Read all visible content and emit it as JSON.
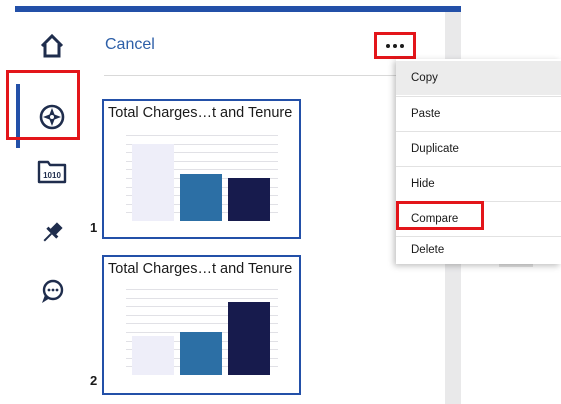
{
  "panel": {
    "cancel_label": "Cancel",
    "more_label": "More options"
  },
  "rail": {
    "items": [
      {
        "name": "home",
        "icon": "home-icon"
      },
      {
        "name": "navigate",
        "icon": "compass-icon",
        "active": true
      },
      {
        "name": "data",
        "icon": "binary-data-icon",
        "label": "1010"
      },
      {
        "name": "pin",
        "icon": "pin-icon"
      },
      {
        "name": "comments",
        "icon": "chat-icon"
      }
    ]
  },
  "cards": [
    {
      "number": "1",
      "title": "Total Charges…t and Tenure"
    },
    {
      "number": "2",
      "title": "Total Charges…t and Tenure"
    }
  ],
  "chart_data": [
    {
      "type": "bar",
      "values": [
        0.9,
        0.55,
        0.5
      ],
      "colors": [
        "#eeeef9",
        "#2c6fa5",
        "#171b4d"
      ]
    },
    {
      "type": "bar",
      "values": [
        0.45,
        0.5,
        0.85
      ],
      "colors": [
        "#eeeef9",
        "#2c6fa5",
        "#171b4d"
      ]
    }
  ],
  "menu": {
    "items": [
      "Copy",
      "Paste",
      "Duplicate",
      "Hide",
      "Compare",
      "Delete"
    ]
  },
  "colors": {
    "accent": "#2350a8",
    "highlight": "#e3151a",
    "rail_icon": "#1f2d4d"
  }
}
